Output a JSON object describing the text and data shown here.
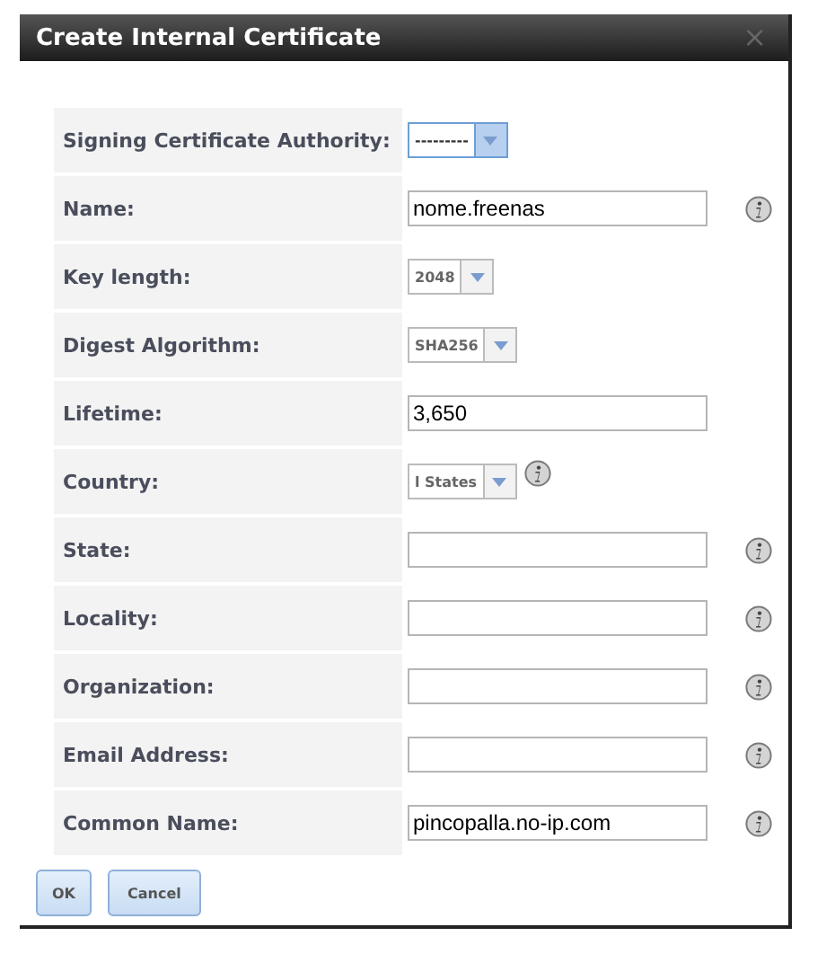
{
  "dialog": {
    "title": "Create Internal Certificate",
    "close": "×"
  },
  "fields": [
    {
      "label": "Signing Certificate Authority:",
      "kind": "select",
      "value": "---------",
      "focused": true,
      "info": false
    },
    {
      "label": "Name:",
      "kind": "text",
      "value": "nome.freenas",
      "info": true
    },
    {
      "label": "Key length:",
      "kind": "select",
      "value": "2048",
      "focused": false,
      "info": false
    },
    {
      "label": "Digest Algorithm:",
      "kind": "select",
      "value": "SHA256",
      "focused": false,
      "info": false
    },
    {
      "label": "Lifetime:",
      "kind": "text",
      "value": "3,650",
      "info": false
    },
    {
      "label": "Country:",
      "kind": "select",
      "value": "l States",
      "focused": false,
      "info": true
    },
    {
      "label": "State:",
      "kind": "text",
      "info": true
    },
    {
      "label": "Locality:",
      "kind": "text",
      "info": true
    },
    {
      "label": "Organization:",
      "kind": "text",
      "info": true
    },
    {
      "label": "Email Address:",
      "kind": "text",
      "info": true
    },
    {
      "label": "Common Name:",
      "kind": "text",
      "value": "pincopalla.no-ip.com",
      "info": true
    }
  ],
  "buttons": [
    "OK",
    "Cancel"
  ]
}
